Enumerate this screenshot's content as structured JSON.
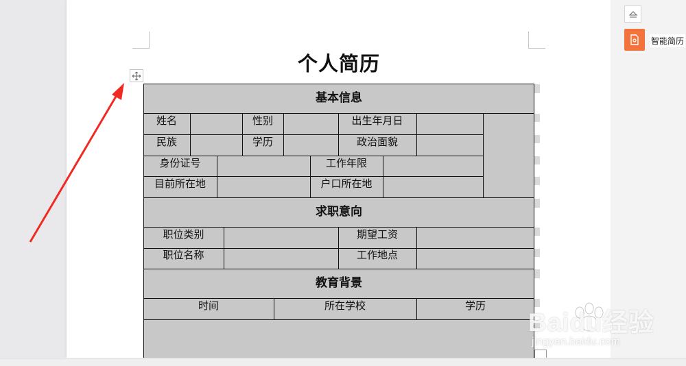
{
  "document": {
    "title": "个人简历"
  },
  "form": {
    "sections": {
      "basic": "基本信息",
      "job_intent": "求职意向",
      "education": "教育背景"
    },
    "basic": {
      "name": "姓名",
      "gender": "性别",
      "birth_date": "出生年月日",
      "ethnicity": "民族",
      "degree": "学历",
      "political_status": "政治面貌",
      "id_number": "身份证号",
      "work_years": "工作年限",
      "current_location": "目前所在地",
      "household_location": "户口所在地"
    },
    "job_intent": {
      "position_type": "职位类别",
      "expected_salary": "期望工资",
      "position_name": "职位名称",
      "work_location": "工作地点"
    },
    "education": {
      "time": "时间",
      "school": "所在学校",
      "degree": "学历"
    }
  },
  "side_panel": {
    "smart_resume_label": "智能简历",
    "accent_color": "#f2733b"
  },
  "watermark": {
    "brand": "Baidu经验",
    "url": "jingyan.baidu.com"
  },
  "annotation": {
    "arrow_color": "#f02a22"
  },
  "icons": [
    "move-handle-icon",
    "collapse-icon",
    "smart-resume-icon",
    "table-resize-icon"
  ]
}
